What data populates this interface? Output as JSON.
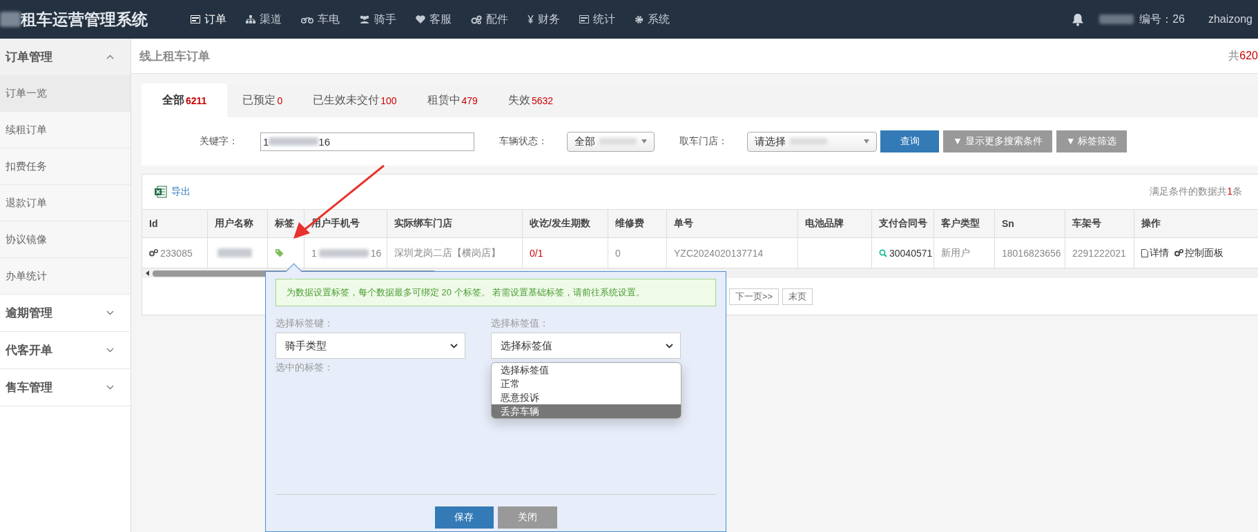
{
  "app": {
    "logo_text": "租车运营管理系统"
  },
  "nav": [
    {
      "label": "订单",
      "selected": true
    },
    {
      "label": "渠道",
      "selected": false
    },
    {
      "label": "车电",
      "selected": false
    },
    {
      "label": "骑手",
      "selected": false
    },
    {
      "label": "客服",
      "selected": false
    },
    {
      "label": "配件",
      "selected": false
    },
    {
      "label": "财务",
      "selected": false
    },
    {
      "label": "统计",
      "selected": false
    },
    {
      "label": "系统",
      "selected": false
    }
  ],
  "user": {
    "id_label": "编号：26",
    "username": "zhaizong"
  },
  "sidebar": [
    {
      "label": "订单管理",
      "expanded": true,
      "children": [
        {
          "label": "订单一览",
          "selected": true
        },
        {
          "label": "续租订单",
          "selected": false
        },
        {
          "label": "扣费任务",
          "selected": false
        },
        {
          "label": "退款订单",
          "selected": false
        },
        {
          "label": "协议镜像",
          "selected": false
        },
        {
          "label": "办单统计",
          "selected": false
        }
      ]
    },
    {
      "label": "逾期管理",
      "expanded": false
    },
    {
      "label": "代客开单",
      "expanded": false
    },
    {
      "label": "售车管理",
      "expanded": false
    }
  ],
  "page": {
    "title": "线上租车订单",
    "total_prefix": "共",
    "total_count": "620"
  },
  "tabs": [
    {
      "label": "全部",
      "count": "6211",
      "selected": true
    },
    {
      "label": "已预定",
      "count": "0",
      "selected": false
    },
    {
      "label": "已生效未交付",
      "count": "100",
      "selected": false
    },
    {
      "label": "租赁中",
      "count": "479",
      "selected": false
    },
    {
      "label": "失效",
      "count": "5632",
      "selected": false
    }
  ],
  "search": {
    "keyword_label": "关键字：",
    "keyword_start": "1",
    "keyword_end": "16",
    "status_label": "车辆状态：",
    "status_value": "全部",
    "store_label": "取车门店：",
    "store_placeholder": "请选择",
    "buttons": [
      {
        "kind": "primary",
        "label": "查询"
      },
      {
        "kind": "toggle",
        "label": "▼ 显示更多搜索条件"
      },
      {
        "kind": "toggle",
        "label": "▼ 标签筛选"
      }
    ]
  },
  "toolbar": {
    "export": "导出",
    "summary_prefix": "满足条件的数据共",
    "summary_count": "1",
    "summary_suffix": "条"
  },
  "table": {
    "columns": [
      "Id",
      "用户名称",
      "标签",
      "用户手机号",
      "实际绑车门店",
      "收讫/发生期数",
      "维修费",
      "单号",
      "电池品牌",
      "支付合同号",
      "客户类型",
      "Sn",
      "车架号",
      "操作"
    ],
    "rows": [
      {
        "id": "233085",
        "phone_start": "1",
        "phone_end": "16",
        "store": "深圳龙岗二店【横岗店】",
        "periods": "0/1",
        "repair_fee": "0",
        "order_no": "YZC2024020137714",
        "contract_no": "30040571",
        "customer_type": "新用户",
        "sn": "18016823656",
        "frame_no": "2291222021",
        "actions": [
          "详情",
          "控制面板"
        ]
      }
    ]
  },
  "pagination": [
    "下一页>>",
    "末页"
  ],
  "tag_popup": {
    "notice": "为数据设置标签，每个数据最多可绑定 20 个标签。 若需设置基础标签，请前往系统设置。",
    "key_label": "选择标签键：",
    "key_value": "骑手类型",
    "value_label": "选择标签值：",
    "value_value": "选择标签值",
    "selected_label": "选中的标签：",
    "options": [
      {
        "label": "选择标签值",
        "selected": false
      },
      {
        "label": "正常",
        "selected": false
      },
      {
        "label": "恶意投诉",
        "selected": false
      },
      {
        "label": "丢弃车辆",
        "selected": true
      }
    ],
    "buttons": [
      {
        "kind": "primary",
        "label": "保存"
      },
      {
        "kind": "secondary",
        "label": "关闭"
      }
    ]
  }
}
